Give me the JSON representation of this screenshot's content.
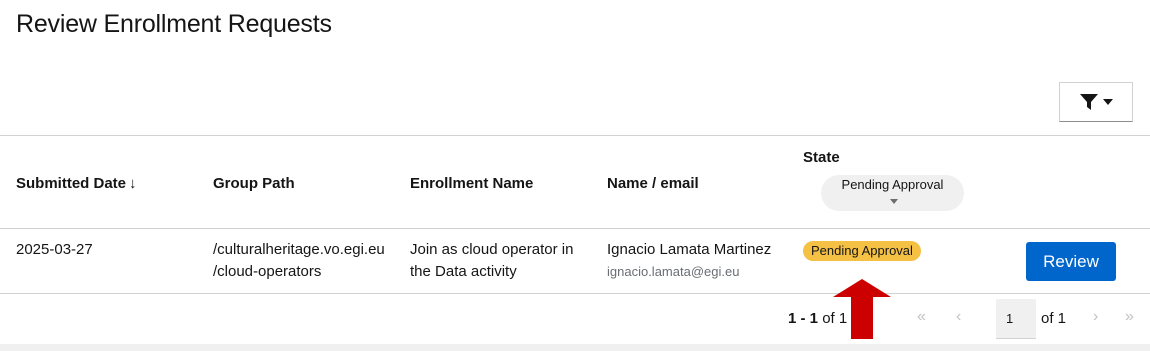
{
  "page": {
    "title": "Review Enrollment Requests"
  },
  "toolbar": {
    "filter_icon": "filter-icon",
    "caret_icon": "caret-down-icon"
  },
  "table": {
    "columns": {
      "submitted_date": "Submitted Date",
      "group_path": "Group Path",
      "enrollment_name": "Enrollment Name",
      "name_email": "Name / email",
      "state": "State"
    },
    "sort_icon": "↓",
    "state_filter": {
      "selected": "Pending Approval"
    },
    "rows": [
      {
        "submitted_date": "2025-03-27",
        "group_path_line1": "/culturalheritage.vo.egi.eu",
        "group_path_line2": "/cloud-operators",
        "enrollment_name_line1": "Join as cloud operator in",
        "enrollment_name_line2": "the Data activity",
        "name": "Ignacio Lamata Martinez",
        "email": "ignacio.lamata@egi.eu",
        "state": "Pending Approval",
        "action": "Review"
      }
    ]
  },
  "pagination": {
    "range": "1 - 1",
    "of_total": "of 1",
    "page_value": "1",
    "of_pages": "of 1"
  },
  "colors": {
    "accent": "#0066cc",
    "badge": "#f4c145",
    "annotation_arrow": "#cc0000"
  }
}
